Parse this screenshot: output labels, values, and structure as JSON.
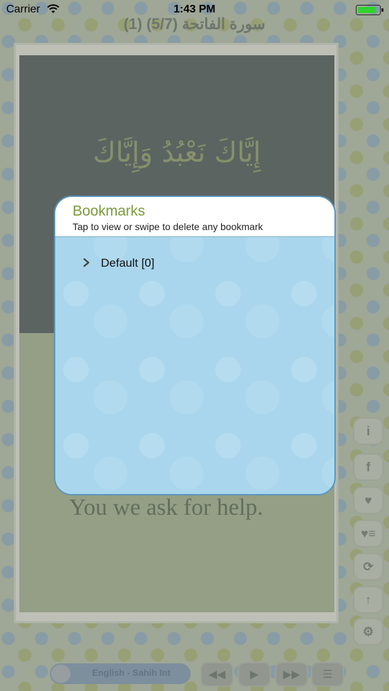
{
  "status_bar": {
    "carrier": "Carrier",
    "time": "1:43 PM",
    "battery_level": 0.85,
    "battery_color": "#2fd32f"
  },
  "nav": {
    "title": "(1) سورة الفاتحة (5/7)"
  },
  "verse": {
    "arabic": "إِيَّاكَ نَعْبُدُ وَإِيَّاكَ",
    "translation": "You we ask for help."
  },
  "side_tools": [
    {
      "icon": "info-icon",
      "glyph": "i"
    },
    {
      "icon": "facebook-icon",
      "glyph": "f"
    },
    {
      "icon": "heart-icon",
      "glyph": "♥"
    },
    {
      "icon": "favorites-list-icon",
      "glyph": "♥≡"
    },
    {
      "icon": "repeat-icon",
      "glyph": "⟳"
    },
    {
      "icon": "arrow-up-icon",
      "glyph": "↑"
    },
    {
      "icon": "settings-icon",
      "glyph": "⚙"
    }
  ],
  "player": {
    "language": "English - Sahih Int",
    "controls": [
      {
        "icon": "rewind-icon",
        "glyph": "◀◀"
      },
      {
        "icon": "play-icon",
        "glyph": "▶"
      },
      {
        "icon": "fast-forward-icon",
        "glyph": "▶▶"
      },
      {
        "icon": "menu-icon",
        "glyph": "☰"
      }
    ]
  },
  "bookmarks": {
    "title": "Bookmarks",
    "subtitle": "Tap to view or swipe to delete any bookmark",
    "groups": [
      {
        "label": "Default [0]"
      }
    ]
  },
  "colors": {
    "accent_green": "#7a9a3a",
    "modal_blue": "#a9d6ec",
    "modal_border": "#5c95b8"
  }
}
